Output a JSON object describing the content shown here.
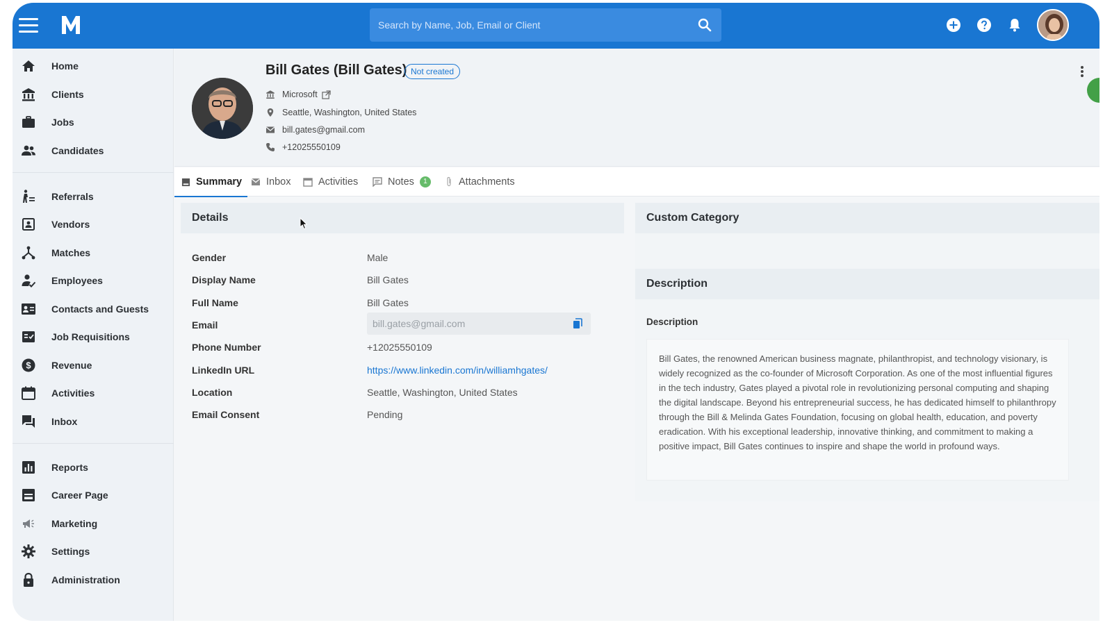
{
  "app": {
    "logo": "M",
    "search": {
      "placeholder": "Search by Name, Job, Email or Client"
    }
  },
  "sidebar": {
    "items": [
      {
        "label": "Home",
        "icon": "home-icon"
      },
      {
        "label": "Clients",
        "icon": "bank-icon"
      },
      {
        "label": "Jobs",
        "icon": "briefcase-icon"
      },
      {
        "label": "Candidates",
        "icon": "people-icon"
      },
      {
        "label": "Referrals",
        "icon": "referral-icon"
      },
      {
        "label": "Vendors",
        "icon": "vendor-icon"
      },
      {
        "label": "Matches",
        "icon": "matches-icon"
      },
      {
        "label": "Employees",
        "icon": "employee-icon"
      },
      {
        "label": "Contacts and Guests",
        "icon": "contact-card-icon"
      },
      {
        "label": "Job Requisitions",
        "icon": "requisition-icon"
      },
      {
        "label": "Revenue",
        "icon": "dollar-icon"
      },
      {
        "label": "Activities",
        "icon": "calendar-icon"
      },
      {
        "label": "Inbox",
        "icon": "chat-icon"
      },
      {
        "label": "Reports",
        "icon": "bar-chart-icon"
      },
      {
        "label": "Career Page",
        "icon": "page-icon"
      },
      {
        "label": "Marketing",
        "icon": "megaphone-icon"
      },
      {
        "label": "Settings",
        "icon": "gear-icon"
      },
      {
        "label": "Administration",
        "icon": "lock-icon"
      }
    ]
  },
  "profile": {
    "name": "Bill Gates (Bill Gates)",
    "status": "Not created",
    "company": "Microsoft",
    "location": "Seattle, Washington, United States",
    "email": "bill.gates@gmail.com",
    "phone": "+12025550109"
  },
  "tabs": {
    "summary": "Summary",
    "inbox": "Inbox",
    "activities": "Activities",
    "notes": "Notes",
    "notes_count": "1",
    "attachments": "Attachments"
  },
  "details": {
    "title": "Details",
    "fields": [
      {
        "label": "Gender",
        "value": "Male"
      },
      {
        "label": "Display Name",
        "value": "Bill Gates"
      },
      {
        "label": "Full Name",
        "value": "Bill Gates"
      },
      {
        "label": "Email",
        "value": "bill.gates@gmail.com"
      },
      {
        "label": "Phone Number",
        "value": "+12025550109"
      },
      {
        "label": "LinkedIn URL",
        "value": "https://www.linkedin.com/in/williamhgates/"
      },
      {
        "label": "Location",
        "value": "Seattle, Washington, United States"
      },
      {
        "label": "Email Consent",
        "value": "Pending"
      }
    ]
  },
  "custom_category": {
    "title": "Custom Category"
  },
  "description": {
    "title": "Description",
    "label": "Description",
    "text": "Bill Gates, the renowned American business magnate, philanthropist, and technology visionary, is widely recognized as the co-founder of Microsoft Corporation. As one of the most influential figures in the tech industry, Gates played a pivotal role in revolutionizing personal computing and shaping the digital landscape. Beyond his entrepreneurial success, he has dedicated himself to philanthropy through the Bill & Melinda Gates Foundation, focusing on global health, education, and poverty eradication. With his exceptional leadership, innovative thinking, and commitment to making a positive impact, Bill Gates continues to inspire and shape the world in profound ways."
  },
  "colors": {
    "primary": "#1976d2",
    "sidebar_bg": "#eef2f6",
    "badge_green": "#66bb6a"
  }
}
